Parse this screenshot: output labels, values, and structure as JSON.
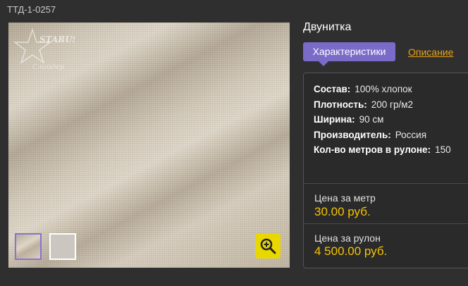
{
  "product": {
    "sku": "ТТД-1-0257",
    "title": "Двунитка"
  },
  "tabs": [
    {
      "label": "Характеристики",
      "active": true
    },
    {
      "label": "Описание",
      "active": false
    }
  ],
  "properties": [
    {
      "key": "Состав:",
      "value": "100% хлопок"
    },
    {
      "key": "Плотность:",
      "value": "200 гр/м2"
    },
    {
      "key": "Ширина:",
      "value": "90 см"
    },
    {
      "key": "Производитель:",
      "value": "Россия"
    },
    {
      "key": "Кол-во метров в рулоне:",
      "value": "150"
    }
  ],
  "prices": {
    "meter": {
      "label": "Цена за метр",
      "value": "30.00 руб."
    },
    "roll": {
      "label": "Цена за рулон",
      "value": "4 500.00 руб."
    }
  },
  "gallery": {
    "logo_text": "STARUS",
    "logo_subtext": "Слайдер",
    "zoom_icon": "magnifier-plus-icon"
  },
  "colors": {
    "accent_tab": "#7b6bc9",
    "link": "#e8a317",
    "price": "#f5c400",
    "zoom_button": "#e8d800"
  }
}
